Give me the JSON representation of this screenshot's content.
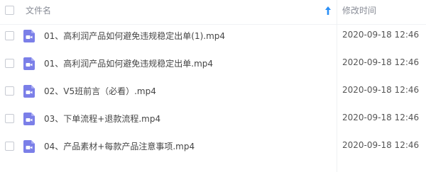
{
  "header": {
    "name_label": "文件名",
    "time_label": "修改时间",
    "sort_icon": "arrow-up-icon"
  },
  "colors": {
    "file_icon": "#7b7fe8",
    "sort_arrow": "#2a8ff7",
    "header_text": "#888c96"
  },
  "files": [
    {
      "name": "01、高利润产品如何避免违规稳定出单(1).mp4",
      "time": "2020-09-18 12:46",
      "icon": "video-file-icon"
    },
    {
      "name": "01、高利润产品如何避免违规稳定出单.mp4",
      "time": "2020-09-18 12:46",
      "icon": "video-file-icon"
    },
    {
      "name": "02、V5班前言（必看）.mp4",
      "time": "2020-09-18 12:46",
      "icon": "video-file-icon"
    },
    {
      "name": "03、下单流程+退款流程.mp4",
      "time": "2020-09-18 12:46",
      "icon": "video-file-icon"
    },
    {
      "name": "04、产品素材+每款产品注意事项.mp4",
      "time": "2020-09-18 12:46",
      "icon": "video-file-icon"
    }
  ]
}
